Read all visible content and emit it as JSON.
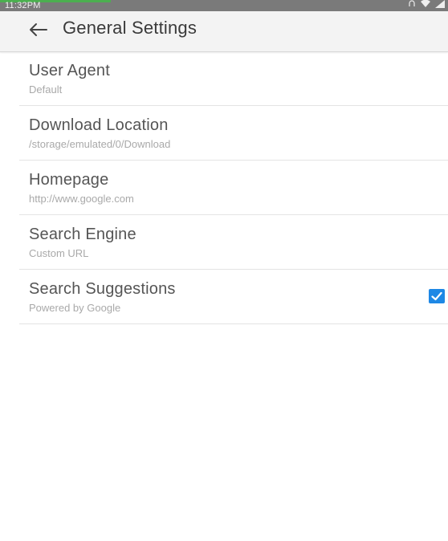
{
  "status_bar": {
    "time": "11:32PM",
    "accent_color": "#4caf50",
    "icons": [
      "notification-icon",
      "wifi-icon",
      "signal-icon"
    ]
  },
  "toolbar": {
    "back_icon": "arrow-back-icon",
    "title": "General Settings"
  },
  "settings": [
    {
      "label": "User Agent",
      "summary": "Default"
    },
    {
      "label": "Download Location",
      "summary": "/storage/emulated/0/Download"
    },
    {
      "label": "Homepage",
      "summary": "http://www.google.com"
    },
    {
      "label": "Search Engine",
      "summary": "Custom URL"
    },
    {
      "label": "Search Suggestions",
      "summary": "Powered by Google",
      "checked": true,
      "checkbox_color": "#1e88e5"
    }
  ]
}
